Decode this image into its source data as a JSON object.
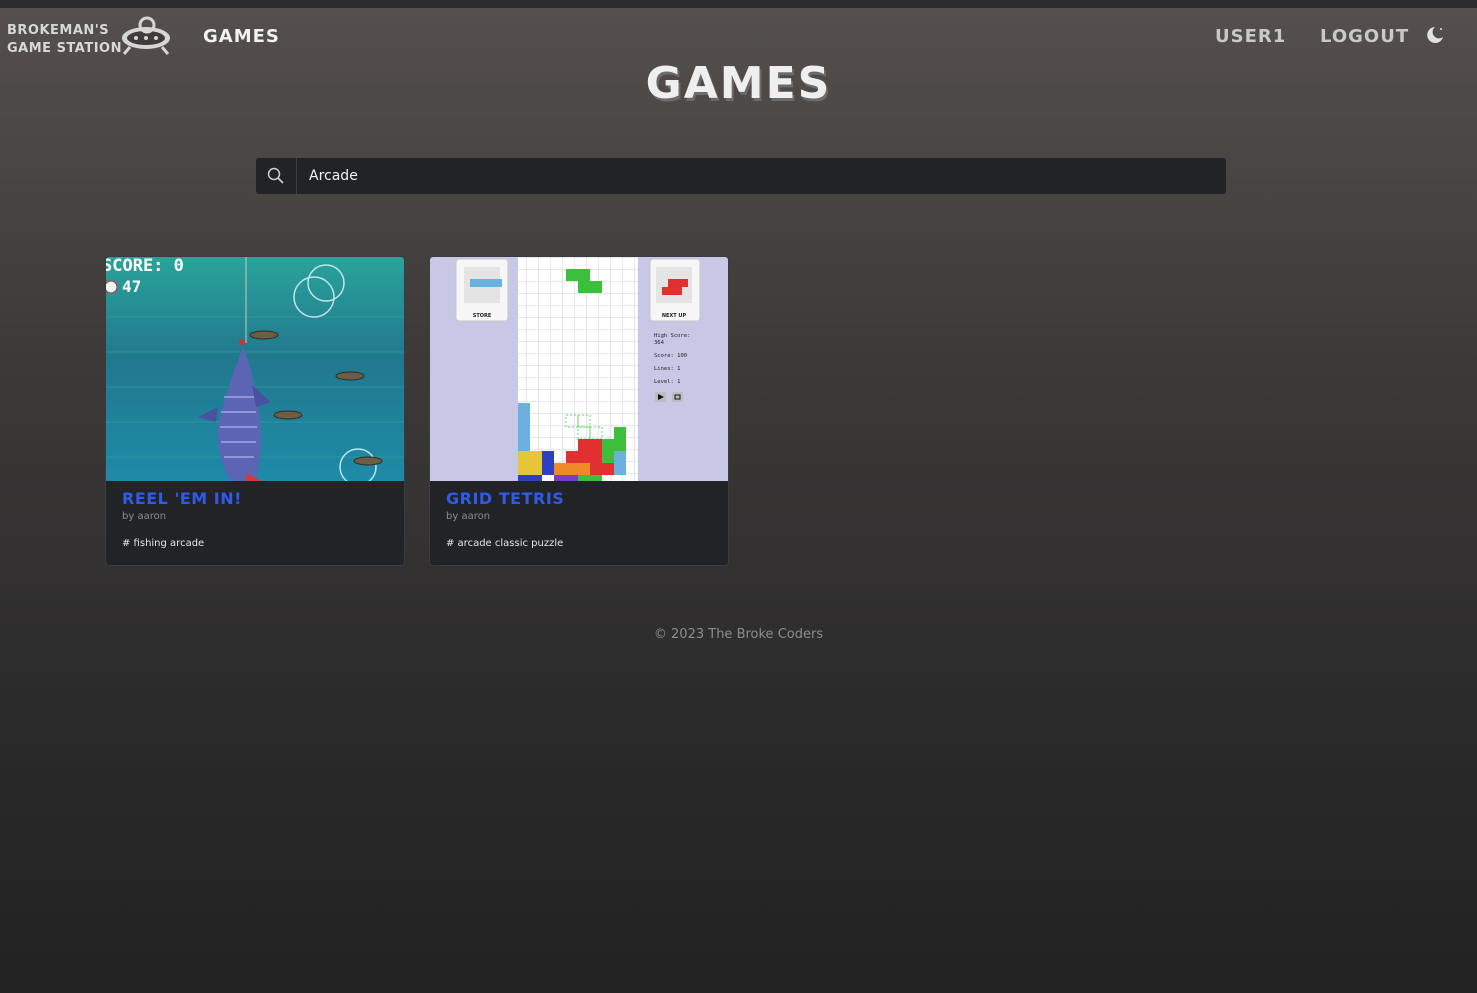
{
  "header": {
    "brand_line1": "Brokeman's",
    "brand_line2": "Game Station",
    "nav_games": "Games",
    "user": "user1",
    "logout": "Logout"
  },
  "page": {
    "title": "Games"
  },
  "search": {
    "value": "Arcade",
    "placeholder": "Search"
  },
  "games": [
    {
      "title": "Reel 'em In!",
      "author": "by aaron",
      "tags": "# fishing arcade",
      "screenshot": {
        "score_text": "SCORE: 0",
        "timer_text": "47"
      }
    },
    {
      "title": "Grid Tetris",
      "author": "by aaron",
      "tags": "# arcade classic puzzle",
      "screenshot": {
        "store_label": "STORE",
        "next_label": "NEXT UP",
        "high_score": "High Score:",
        "high_score_value": "364",
        "score": "Score: 100",
        "lines": "Lines: 1",
        "level": "Level: 1"
      }
    }
  ],
  "footer": {
    "text": "© 2023 The Broke Coders"
  },
  "colors": {
    "accent": "#2f5be8",
    "card_bg": "#212327",
    "search_bg": "#212326"
  }
}
